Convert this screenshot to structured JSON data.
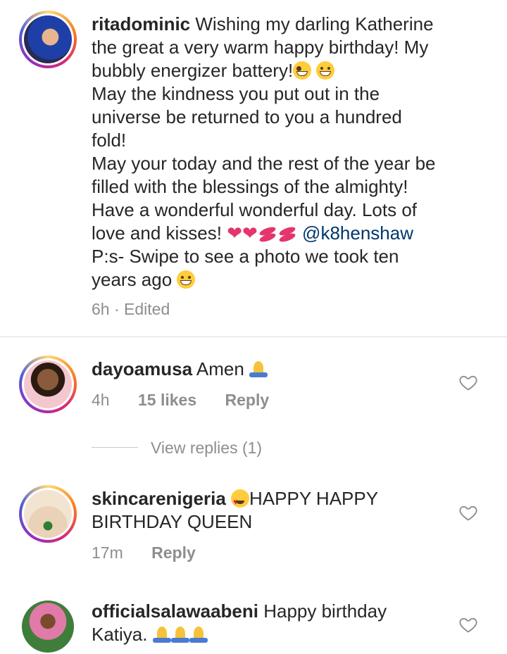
{
  "post": {
    "username": "ritadominic",
    "caption_1": "Wishing my darling Katherine",
    "caption_2": "the great a very warm happy birthday! My",
    "caption_3": "bubbly energizer battery!",
    "caption_4": "May the kindness you put out in the",
    "caption_5": "universe be returned to you a hundred",
    "caption_6": "fold!",
    "caption_7": "May your today and the rest of the year be",
    "caption_8": "filled with the blessings of the almighty!",
    "caption_9": "Have a wonderful wonderful day. Lots of",
    "caption_10": "love and kisses!",
    "mention": "@k8henshaw",
    "caption_11": "P:s- Swipe to see a photo we took ten",
    "caption_12": "years ago",
    "time": "6h",
    "edited": "· Edited"
  },
  "comments": [
    {
      "username": "dayoamusa",
      "text": "Amen",
      "time": "4h",
      "likes": "15 likes",
      "reply": "Reply",
      "view_replies": "View replies (1)"
    },
    {
      "username": "skincarenigeria",
      "text_1": "HAPPY HAPPY",
      "text_2": "BIRTHDAY QUEEN",
      "time": "17m",
      "reply": "Reply"
    },
    {
      "username": "officialsalawaabeni",
      "text_1": "Happy birthday",
      "text_2": "Katiya."
    }
  ],
  "icons": [
    "heart-outline-icon",
    "pray-emoji",
    "heart-emoji",
    "kiss-emoji",
    "grin-emoji"
  ]
}
